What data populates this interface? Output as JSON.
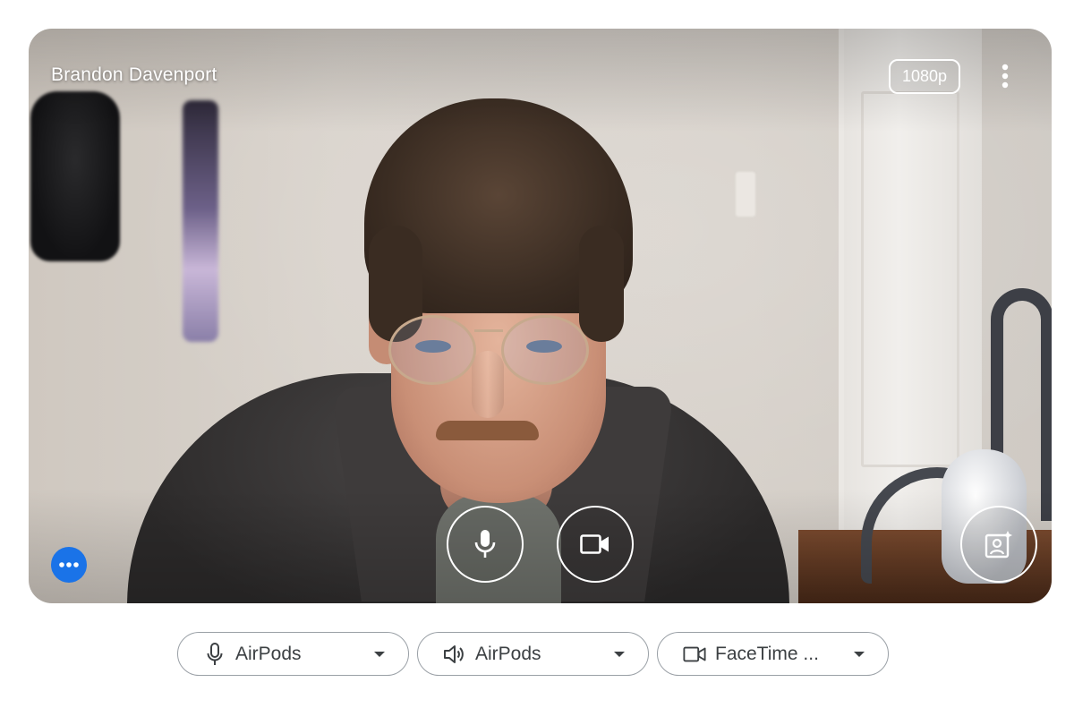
{
  "preview": {
    "participant_name": "Brandon Davenport",
    "resolution_badge": "1080p",
    "icons": {
      "more": "more-vert-icon",
      "mic": "mic-icon",
      "camera": "videocam-icon",
      "effects": "visual-effects-icon",
      "options": "more-horiz-icon"
    }
  },
  "devices": [
    {
      "icon": "mic-icon",
      "label": "AirPods"
    },
    {
      "icon": "speaker-icon",
      "label": "AirPods"
    },
    {
      "icon": "videocam-icon",
      "label": "FaceTime ..."
    }
  ],
  "colors": {
    "accent": "#1a73e8",
    "text": "#3c4043",
    "border": "#9aa0a6",
    "overlay": "#ffffff"
  }
}
